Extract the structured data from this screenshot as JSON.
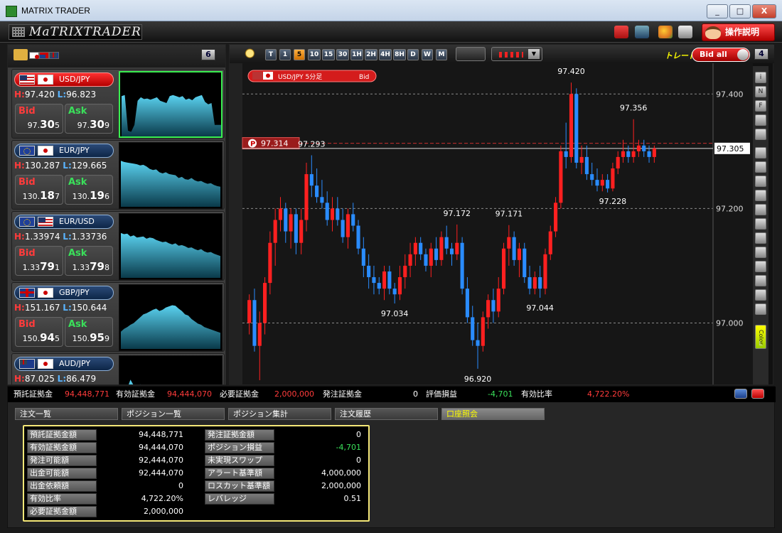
{
  "window": {
    "title": "MATRIX TRADER",
    "min": "_",
    "max": "□",
    "close": "X"
  },
  "toolbar": {
    "logo": "MaTRIXTRADER",
    "help_label": "操作説明"
  },
  "left_panel": {
    "badge": "6",
    "pairs": [
      {
        "name": "USD/JPY",
        "flags": [
          "us",
          "jp"
        ],
        "high_prefix": "H:",
        "high": "97.420",
        "low_prefix": "L:",
        "low": "96.823",
        "bid_label": "Bid",
        "bid_small": "97.",
        "bid_big": "30",
        "bid_end": "5",
        "ask_label": "Ask",
        "ask_small": "97.",
        "ask_big": "30",
        "ask_end": "9",
        "active": true,
        "spark": [
          0.7,
          0.72,
          0.1,
          0.08,
          0.2,
          0.62,
          0.68,
          0.65,
          0.66,
          0.64,
          0.66,
          0.68,
          0.62,
          0.6,
          0.58,
          0.7,
          0.72,
          0.7,
          0.68,
          0.7,
          0.64,
          0.66,
          0.63,
          0.68,
          0.7,
          0.72,
          0.6,
          0.56,
          0.58,
          0.2,
          0.2,
          0.2
        ]
      },
      {
        "name": "EUR/JPY",
        "flags": [
          "eu",
          "jp"
        ],
        "high_prefix": "H:",
        "high": "130.287",
        "low_prefix": "L:",
        "low": "129.665",
        "bid_label": "Bid",
        "bid_small": "130.",
        "bid_big": "18",
        "bid_end": "7",
        "ask_label": "Ask",
        "ask_small": "130.",
        "ask_big": "19",
        "ask_end": "6",
        "active": false,
        "spark": [
          0.8,
          0.78,
          0.77,
          0.76,
          0.75,
          0.74,
          0.72,
          0.73,
          0.7,
          0.66,
          0.64,
          0.65,
          0.6,
          0.58,
          0.6,
          0.57,
          0.56,
          0.55,
          0.5,
          0.52,
          0.48,
          0.47,
          0.5,
          0.46,
          0.44,
          0.45,
          0.42,
          0.4,
          0.41,
          0.38,
          0.36,
          0.35
        ]
      },
      {
        "name": "EUR/USD",
        "flags": [
          "eu",
          "us"
        ],
        "high_prefix": "H:",
        "high": "1.33974",
        "low_prefix": "L:",
        "low": "1.33736",
        "bid_label": "Bid",
        "bid_small": "1.33",
        "bid_big": "79",
        "bid_end": "1",
        "ask_label": "Ask",
        "ask_small": "1.33",
        "ask_big": "79",
        "ask_end": "8",
        "active": false,
        "spark": [
          0.78,
          0.76,
          0.77,
          0.72,
          0.74,
          0.7,
          0.71,
          0.72,
          0.68,
          0.7,
          0.69,
          0.66,
          0.64,
          0.62,
          0.63,
          0.6,
          0.58,
          0.6,
          0.56,
          0.57,
          0.55,
          0.52,
          0.53,
          0.5,
          0.48,
          0.5,
          0.46,
          0.44,
          0.45,
          0.42,
          0.4,
          0.38
        ]
      },
      {
        "name": "GBP/JPY",
        "flags": [
          "gb",
          "jp"
        ],
        "high_prefix": "H:",
        "high": "151.167",
        "low_prefix": "L:",
        "low": "150.644",
        "bid_label": "Bid",
        "bid_small": "150.",
        "bid_big": "94",
        "bid_end": "5",
        "ask_label": "Ask",
        "ask_small": "150.",
        "ask_big": "95",
        "ask_end": "9",
        "active": false,
        "spark": [
          0.3,
          0.35,
          0.38,
          0.42,
          0.45,
          0.5,
          0.55,
          0.6,
          0.62,
          0.65,
          0.68,
          0.7,
          0.66,
          0.68,
          0.72,
          0.74,
          0.76,
          0.75,
          0.7,
          0.66,
          0.6,
          0.58,
          0.52,
          0.48,
          0.44,
          0.42,
          0.38,
          0.36,
          0.34,
          0.32,
          0.3,
          0.28
        ]
      },
      {
        "name": "AUD/JPY",
        "flags": [
          "au",
          "jp"
        ],
        "high_prefix": "H:",
        "high": "87.025",
        "low_prefix": "L:",
        "low": "86.479",
        "bid_label": "Bid",
        "bid_small": "",
        "bid_big": "",
        "bid_end": "",
        "ask_label": "Ask",
        "ask_small": "",
        "ask_big": "",
        "ask_end": "",
        "active": false,
        "spark": [
          0.5,
          0.6,
          0.55,
          0.7,
          0.6,
          0.58,
          0.62,
          0.6,
          0.55,
          0.5,
          0.48,
          0.45,
          0.46,
          0.44,
          0.42,
          0.4,
          0.38,
          0.36,
          0.35,
          0.34,
          0.33,
          0.32,
          0.31,
          0.3,
          0.3,
          0.29,
          0.28,
          0.27,
          0.26,
          0.25,
          0.24,
          0.22
        ]
      }
    ]
  },
  "chart_panel": {
    "timeframes": [
      "T",
      "1",
      "5",
      "10",
      "15",
      "30",
      "1H",
      "2H",
      "4H",
      "8H",
      "D",
      "W",
      "M"
    ],
    "active_timeframe": "5",
    "trade_label": "トレード",
    "bid_all_label": "Bid all",
    "badge": "4",
    "chart_title": "USD/JPY 5分足",
    "chart_side": "Bid",
    "position_marker": "97.314",
    "position_icon": "P",
    "right_tools": [
      "i",
      "N",
      "F",
      "bell",
      "ind",
      "arrow",
      "cross",
      "line",
      "hline",
      "vline",
      "fib",
      "list",
      "list2",
      "fan",
      "text",
      "pencil",
      "trash",
      "Color",
      "L"
    ]
  },
  "chart_data": {
    "type": "candlestick",
    "ylim": [
      96.9,
      97.45
    ],
    "y_ticks": [
      "97.400",
      "97.200",
      "97.000"
    ],
    "y_tick_values": [
      97.4,
      97.2,
      97.0
    ],
    "current_price": "97.305",
    "current_value": 97.305,
    "position_value": 97.314,
    "annotations": [
      {
        "label": "97.293",
        "candle": 12,
        "side": "high"
      },
      {
        "label": "97.034",
        "candle": 28,
        "side": "low"
      },
      {
        "label": "97.172",
        "candle": 40,
        "side": "high"
      },
      {
        "label": "96.920",
        "candle": 44,
        "side": "low"
      },
      {
        "label": "97.171",
        "candle": 50,
        "side": "high"
      },
      {
        "label": "97.044",
        "candle": 56,
        "side": "low"
      },
      {
        "label": "97.420",
        "candle": 62,
        "side": "high"
      },
      {
        "label": "97.228",
        "candle": 70,
        "side": "low"
      },
      {
        "label": "97.356",
        "candle": 74,
        "side": "high"
      }
    ],
    "candles": [
      [
        97.0,
        97.05,
        96.98,
        97.04
      ],
      [
        97.04,
        97.06,
        96.95,
        96.96
      ],
      [
        96.96,
        97.02,
        96.9,
        97.0
      ],
      [
        97.0,
        97.08,
        96.98,
        97.07
      ],
      [
        97.07,
        97.16,
        97.05,
        97.14
      ],
      [
        97.14,
        97.2,
        97.1,
        97.18
      ],
      [
        97.18,
        97.22,
        97.16,
        97.2
      ],
      [
        97.2,
        97.21,
        97.14,
        97.16
      ],
      [
        97.16,
        97.2,
        97.13,
        97.19
      ],
      [
        97.19,
        97.2,
        97.12,
        97.14
      ],
      [
        97.14,
        97.2,
        97.12,
        97.18
      ],
      [
        97.18,
        97.28,
        97.16,
        97.26
      ],
      [
        97.26,
        97.293,
        97.22,
        97.24
      ],
      [
        97.24,
        97.27,
        97.21,
        97.22
      ],
      [
        97.22,
        97.25,
        97.2,
        97.21
      ],
      [
        97.21,
        97.23,
        97.17,
        97.18
      ],
      [
        97.18,
        97.22,
        97.16,
        97.2
      ],
      [
        97.2,
        97.22,
        97.17,
        97.18
      ],
      [
        97.18,
        97.2,
        97.14,
        97.15
      ],
      [
        97.15,
        97.2,
        97.13,
        97.19
      ],
      [
        97.19,
        97.21,
        97.16,
        97.17
      ],
      [
        97.17,
        97.18,
        97.12,
        97.13
      ],
      [
        97.13,
        97.15,
        97.08,
        97.1
      ],
      [
        97.1,
        97.12,
        97.06,
        97.08
      ],
      [
        97.08,
        97.1,
        97.05,
        97.07
      ],
      [
        97.07,
        97.08,
        97.05,
        97.06
      ],
      [
        97.06,
        97.1,
        97.04,
        97.09
      ],
      [
        97.09,
        97.1,
        97.05,
        97.06
      ],
      [
        97.06,
        97.07,
        97.034,
        97.05
      ],
      [
        97.05,
        97.1,
        97.04,
        97.08
      ],
      [
        97.08,
        97.12,
        97.06,
        97.1
      ],
      [
        97.1,
        97.14,
        97.08,
        97.12
      ],
      [
        97.12,
        97.15,
        97.1,
        97.14
      ],
      [
        97.14,
        97.15,
        97.11,
        97.12
      ],
      [
        97.12,
        97.13,
        97.09,
        97.1
      ],
      [
        97.1,
        97.14,
        97.08,
        97.13
      ],
      [
        97.13,
        97.15,
        97.1,
        97.11
      ],
      [
        97.11,
        97.16,
        97.1,
        97.15
      ],
      [
        97.15,
        97.17,
        97.12,
        97.13
      ],
      [
        97.13,
        97.14,
        97.1,
        97.12
      ],
      [
        97.12,
        97.172,
        97.11,
        97.14
      ],
      [
        97.14,
        97.15,
        97.05,
        97.06
      ],
      [
        97.06,
        97.08,
        97.0,
        97.01
      ],
      [
        97.01,
        97.03,
        96.96,
        96.97
      ],
      [
        96.97,
        97.0,
        96.92,
        96.96
      ],
      [
        96.96,
        97.02,
        96.95,
        97.01
      ],
      [
        97.01,
        97.05,
        96.99,
        97.04
      ],
      [
        97.04,
        97.06,
        97.0,
        97.02
      ],
      [
        97.02,
        97.08,
        97.01,
        97.06
      ],
      [
        97.06,
        97.14,
        97.05,
        97.13
      ],
      [
        97.13,
        97.171,
        97.1,
        97.15
      ],
      [
        97.15,
        97.16,
        97.1,
        97.11
      ],
      [
        97.11,
        97.14,
        97.08,
        97.13
      ],
      [
        97.13,
        97.14,
        97.07,
        97.08
      ],
      [
        97.08,
        97.1,
        97.05,
        97.06
      ],
      [
        97.06,
        97.09,
        97.05,
        97.08
      ],
      [
        97.08,
        97.1,
        97.044,
        97.06
      ],
      [
        97.06,
        97.13,
        97.05,
        97.12
      ],
      [
        97.12,
        97.17,
        97.11,
        97.16
      ],
      [
        97.16,
        97.22,
        97.15,
        97.21
      ],
      [
        97.21,
        97.31,
        97.2,
        97.3
      ],
      [
        97.3,
        97.35,
        97.27,
        97.29
      ],
      [
        97.29,
        97.42,
        97.28,
        97.4
      ],
      [
        97.4,
        97.41,
        97.27,
        97.28
      ],
      [
        97.28,
        97.31,
        97.26,
        97.29
      ],
      [
        97.29,
        97.31,
        97.25,
        97.26
      ],
      [
        97.26,
        97.28,
        97.24,
        97.25
      ],
      [
        97.25,
        97.27,
        97.23,
        97.24
      ],
      [
        97.24,
        97.26,
        97.23,
        97.25
      ],
      [
        97.25,
        97.26,
        97.228,
        97.235
      ],
      [
        97.235,
        97.28,
        97.23,
        97.27
      ],
      [
        97.27,
        97.3,
        97.26,
        97.29
      ],
      [
        97.29,
        97.32,
        97.28,
        97.3
      ],
      [
        97.3,
        97.31,
        97.28,
        97.29
      ],
      [
        97.29,
        97.356,
        97.28,
        97.3
      ],
      [
        97.3,
        97.32,
        97.29,
        97.31
      ],
      [
        97.31,
        97.32,
        97.29,
        97.3
      ],
      [
        97.3,
        97.31,
        97.28,
        97.29
      ],
      [
        97.29,
        97.31,
        97.28,
        97.305
      ]
    ]
  },
  "summary": [
    {
      "label": "預託証拠金",
      "value": "94,448,771",
      "color": "#ff3b3b"
    },
    {
      "label": "有効証拠金",
      "value": "94,444,070",
      "color": "#ff3b3b"
    },
    {
      "label": "必要証拠金",
      "value": "2,000,000",
      "color": "#ff3b3b"
    },
    {
      "label": "発注証拠金",
      "value": "0",
      "color": "#ffffff"
    },
    {
      "label": "評価損益",
      "value": "-4,701",
      "color": "#3ae05a"
    },
    {
      "label": "有効比率",
      "value": "4,722.20%",
      "color": "#ff3b3b"
    }
  ],
  "tabs": [
    "注文一覧",
    "ポジション一覧",
    "ポジション集計",
    "注文履歴",
    "口座照会"
  ],
  "active_tab": 4,
  "account_left": [
    {
      "label": "預託証拠金額",
      "value": "94,448,771"
    },
    {
      "label": "有効証拠金額",
      "value": "94,444,070"
    },
    {
      "label": "発注可能額",
      "value": "92,444,070"
    },
    {
      "label": "出金可能額",
      "value": "92,444,070"
    },
    {
      "label": "出金依頼額",
      "value": "0"
    },
    {
      "label": "有効比率",
      "value": "4,722.20%"
    },
    {
      "label": "必要証拠金額",
      "value": "2,000,000"
    }
  ],
  "account_right": [
    {
      "label": "発注証拠金額",
      "value": "0",
      "color": "#ffffff"
    },
    {
      "label": "ポジション損益",
      "value": "-4,701",
      "color": "#3ae05a"
    },
    {
      "label": "未実現スワップ",
      "value": "0",
      "color": "#ffffff"
    },
    {
      "label": "アラート基準額",
      "value": "4,000,000",
      "color": "#ffffff"
    },
    {
      "label": "ロスカット基準額",
      "value": "2,000,000",
      "color": "#ffffff"
    },
    {
      "label": "レバレッジ",
      "value": "0.51",
      "color": "#ffffff"
    }
  ]
}
